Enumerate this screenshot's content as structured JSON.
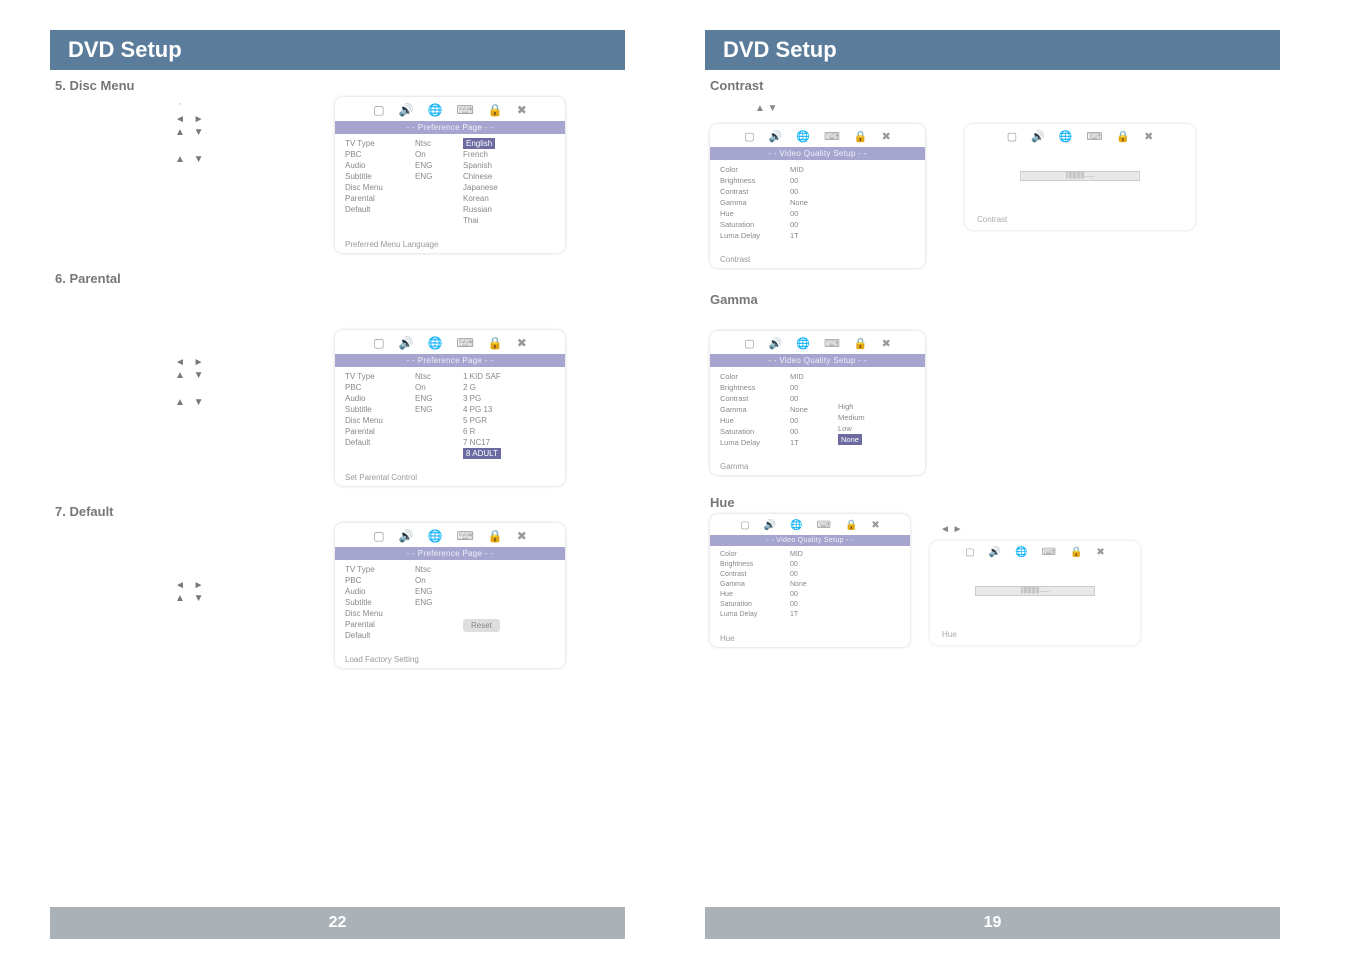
{
  "pageLeft": {
    "title": "DVD Setup",
    "sections": {
      "discMenu": {
        "heading": "5. Disc Menu"
      },
      "parental": {
        "heading": "6. Parental"
      },
      "defaultSec": {
        "heading": "7. Default"
      }
    },
    "arrows": {
      "lr": "◄  ►",
      "ud": "▲  ▼"
    },
    "footer": "22",
    "osd1": {
      "header": "- - Preference Page - -",
      "col1": [
        "TV Type",
        "PBC",
        "Audio",
        "Subtitle",
        "Disc Menu",
        "Parental",
        "Default"
      ],
      "col2": [
        "Ntsc",
        "On",
        "ENG",
        "",
        "ENG",
        "",
        ""
      ],
      "col3": [
        "English",
        "French",
        "Spanish",
        "Chinese",
        "Japanese",
        "Korean",
        "Russian",
        "Thai"
      ],
      "footer": "Preferred Menu Language"
    },
    "osd2": {
      "header": "- - Preference Page - -",
      "col1": [
        "TV Type",
        "PBC",
        "Audio",
        "Subtitle",
        "Disc Menu",
        "Parental",
        "Default"
      ],
      "col2": [
        "Ntsc",
        "On",
        "ENG",
        "",
        "ENG",
        "",
        ""
      ],
      "col3": [
        "1 KID SAF",
        "2 G",
        "3 PG",
        "4 PG 13",
        "5 PGR",
        "6 R",
        "7 NC17",
        "8 ADULT"
      ],
      "footer": "Set Parental Control"
    },
    "osd3": {
      "header": "- - Preference Page - -",
      "col1": [
        "TV Type",
        "PBC",
        "Audio",
        "Subtitle",
        "Disc Menu",
        "Parental",
        "Default"
      ],
      "col2": [
        "Ntsc",
        "On",
        "ENG",
        "",
        "ENG",
        "",
        ""
      ],
      "reset": "Reset",
      "footer": "Load Factory Setting"
    }
  },
  "pageRight": {
    "title": "DVD Setup",
    "sections": {
      "contrast": {
        "heading": "Contrast"
      },
      "gamma": {
        "heading": "Gamma"
      },
      "hue": {
        "heading": "Hue"
      }
    },
    "arrows": {
      "lr": "◄  ►",
      "ud": "▲  ▼"
    },
    "footer": "19",
    "osdVQ": {
      "header": "- - Video Quality Setup - -",
      "col1": [
        "Color",
        "Brightness",
        "Contrast",
        "Gamma",
        "Hue",
        "Saturation",
        "Luma Delay"
      ],
      "col2": [
        "MID",
        "00",
        "00",
        "None",
        "00",
        "00",
        "1T"
      ]
    },
    "osdGamma": {
      "col3": [
        "High",
        "Medium",
        "Low",
        "None"
      ]
    },
    "sliderContrast": {
      "footer": "Contrast",
      "track": "||||||||||||||......."
    },
    "sliderHue": {
      "footer": "Hue",
      "track": "||||||||||||||......."
    },
    "footerContrast": "Contrast",
    "footerGamma": "Gamma",
    "footerHue": "Hue"
  }
}
